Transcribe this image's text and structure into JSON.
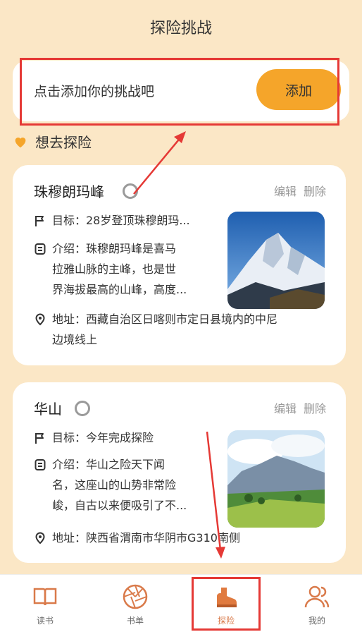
{
  "page": {
    "title": "探险挑战"
  },
  "add": {
    "prompt": "点击添加你的挑战吧",
    "button": "添加"
  },
  "section": {
    "title": "想去探险"
  },
  "cards": [
    {
      "name": "珠穆朗玛峰",
      "edit": "编辑",
      "delete": "删除",
      "goal": "目标：28岁登顶珠穆朗玛...",
      "intro": "介绍：珠穆朗玛峰是喜马\n拉雅山脉的主峰，也是世\n界海拔最高的山峰，高度...",
      "address": "地址：西藏自治区日喀则市定日县境内的中尼\n边境线上",
      "image": "snowy-mountain"
    },
    {
      "name": "华山",
      "edit": "编辑",
      "delete": "删除",
      "goal": "目标：今年完成探险",
      "intro": "介绍：华山之险天下闻\n名，这座山的山势非常险\n峻，自古以来便吸引了不...",
      "address": "地址：陕西省渭南市华阴市G310南侧",
      "image": "green-valley"
    }
  ],
  "tabs": [
    {
      "label": "读书",
      "icon": "book-icon"
    },
    {
      "label": "书单",
      "icon": "aperture-icon"
    },
    {
      "label": "探险",
      "icon": "boot-icon",
      "active": true
    },
    {
      "label": "我的",
      "icon": "user-icon"
    }
  ],
  "colors": {
    "background": "#fbe7c6",
    "accent": "#f5a52a",
    "highlight": "#e53935",
    "tab_active": "#d97a4a"
  }
}
